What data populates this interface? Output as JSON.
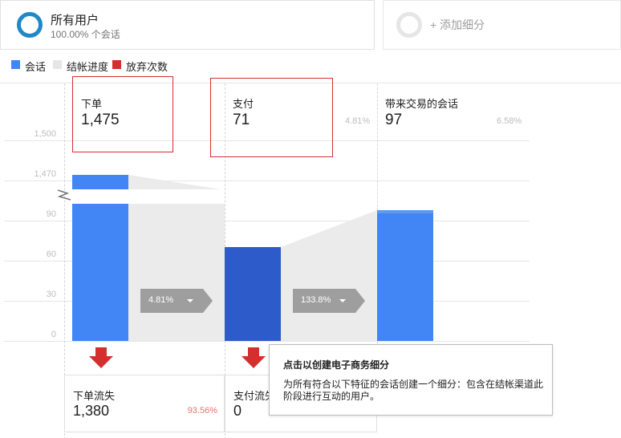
{
  "segments": {
    "all_users": {
      "name": "所有用户",
      "subtitle": "100.00% 个会话"
    },
    "add_label": "+ 添加细分"
  },
  "legend": [
    {
      "label": "会话",
      "color": "#4285f4"
    },
    {
      "label": "结帐进度",
      "color": "#e6e6e6"
    },
    {
      "label": "放弃次数",
      "color": "#d32f2f"
    }
  ],
  "steps": [
    {
      "label": "下单",
      "value": "1,475"
    },
    {
      "label": "支付",
      "value": "71",
      "pct": "4.81%"
    },
    {
      "label": "带来交易的会话",
      "value": "97",
      "pct": "6.58%"
    }
  ],
  "y_ticks": [
    "1,500",
    "1,470",
    "90",
    "60",
    "30",
    "0"
  ],
  "conversions": [
    "4.81%",
    "133.8%"
  ],
  "dropoffs": [
    {
      "label": "下单流失",
      "value": "1,380",
      "pct": "93.56%"
    },
    {
      "label": "支付流失",
      "value": "0"
    }
  ],
  "tooltip": {
    "title": "点击以创建电子商务细分",
    "body": "为所有符合以下特征的会话创建一个细分：包含在结帐渠道此阶段进行互动的用户。"
  },
  "chart_data": {
    "type": "bar",
    "categories": [
      "下单",
      "支付",
      "带来交易的会话"
    ],
    "series": [
      {
        "name": "会话",
        "values": [
          1475,
          71,
          97
        ]
      }
    ],
    "conversion_rates": [
      "4.81%",
      "133.8%"
    ],
    "dropoffs": [
      1380,
      0
    ],
    "y_ticks": [
      "1,500",
      "1,470",
      "90",
      "60",
      "30",
      "0"
    ],
    "axis_break": true,
    "colors": {
      "bar": "#4285f4",
      "bar_selected": "#2d5bc9",
      "progress": "#ebebeb",
      "abandon": "#d32f2f"
    }
  }
}
